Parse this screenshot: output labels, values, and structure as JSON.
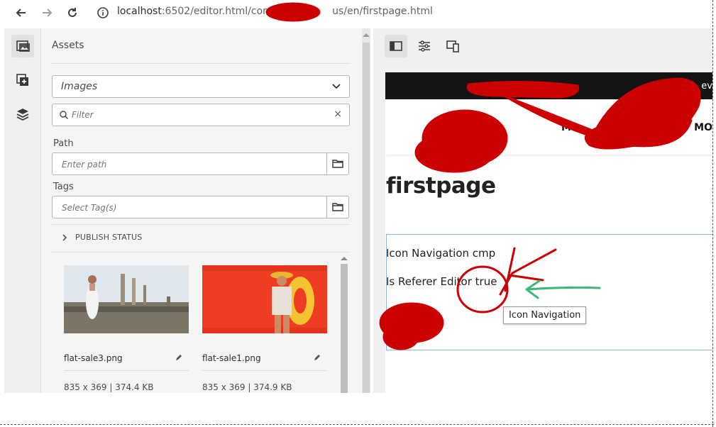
{
  "browser": {
    "url_host": "localhost",
    "url_rest": ":6502/editor.html/conte",
    "url_tail": "us/en/firstpage.html",
    "icons": [
      "back-arrow-icon",
      "forward-arrow-icon",
      "reload-icon",
      "info-icon"
    ]
  },
  "rail": {
    "items": [
      {
        "name": "assets-icon",
        "active": true
      },
      {
        "name": "components-icon",
        "active": false
      },
      {
        "name": "content-tree-icon",
        "active": false
      }
    ]
  },
  "assets": {
    "title": "Assets",
    "type_select": {
      "value": "Images"
    },
    "filter": {
      "placeholder": "Filter",
      "clear": "×"
    },
    "path": {
      "label": "Path",
      "placeholder": "Enter path"
    },
    "tags": {
      "label": "Tags",
      "placeholder": "Select Tag(s)"
    },
    "publish_status": "PUBLISH STATUS",
    "cards": [
      {
        "name": "flat-sale3.png",
        "meta": "835 x 369 | 374.4 KB"
      },
      {
        "name": "flat-sale1.png",
        "meta": "835 x 369 | 374.9 KB"
      }
    ]
  },
  "editor": {
    "toolbar": [
      "side-panel-icon",
      "page-properties-icon",
      "emulator-icon"
    ],
    "site": {
      "top_text": "ev",
      "nav_left": "M",
      "nav_right": "MO"
    },
    "page_title": "firstpage",
    "component": {
      "line1": "Icon Navigation cmp",
      "line2": "Is Referer Editor true"
    },
    "tooltip": "Icon Navigation"
  },
  "colors": {
    "scribble_red": "#cc0000",
    "arrow_green": "#3cb878",
    "highlight_border": "#8ab4e0"
  }
}
